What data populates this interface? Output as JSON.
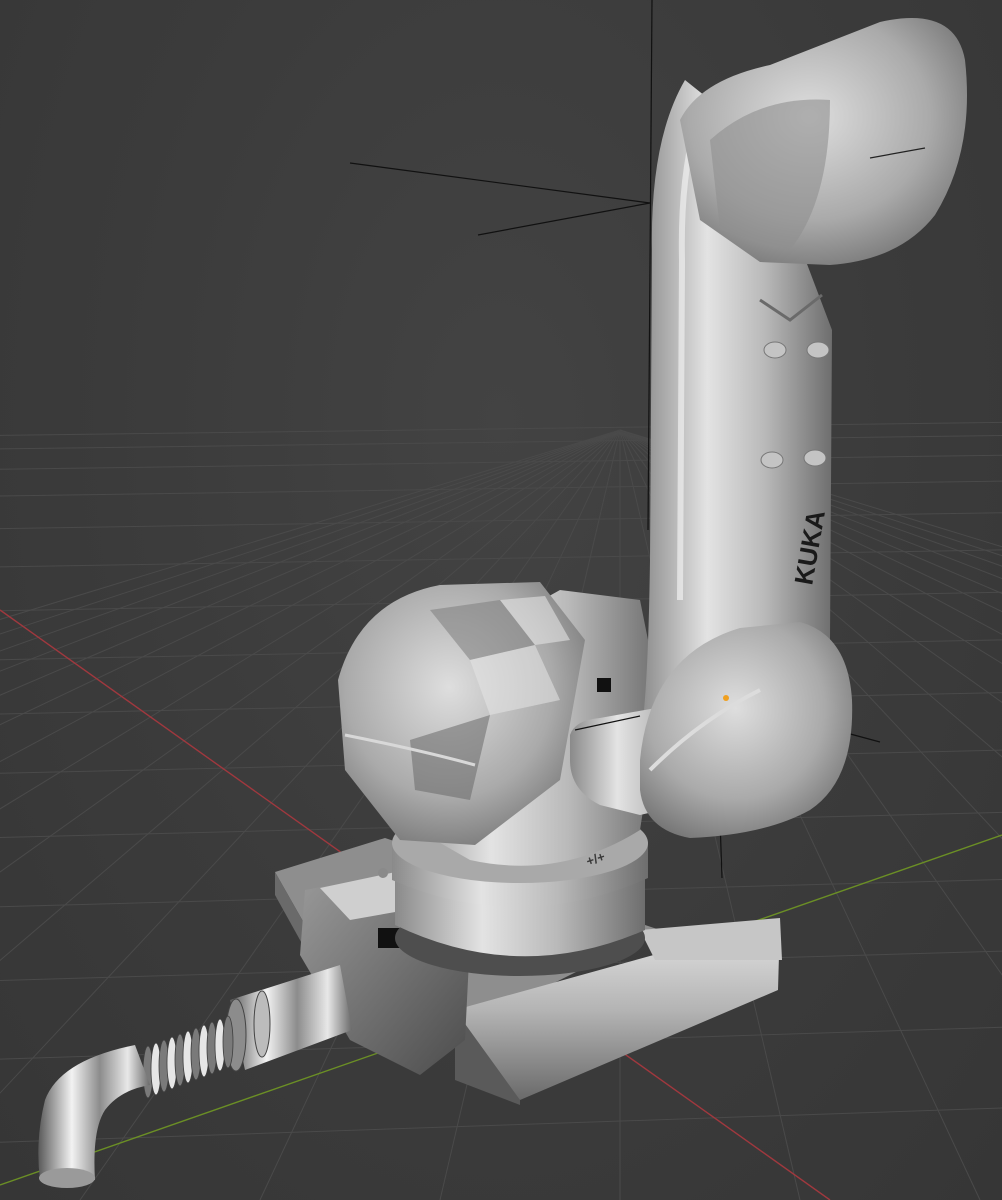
{
  "viewport": {
    "background_color": "#3d3d3d",
    "grid_color": "#4a4a4a",
    "x_axis_color": "#a0383e",
    "y_axis_color": "#6b8f25"
  },
  "model": {
    "brand_label": "KUKA",
    "marking_label": "+/+",
    "metal_light": "#e4e4e4",
    "metal_mid": "#a9a9a9",
    "metal_dark": "#5c5c5c",
    "chrome_color": "#cfcfcf",
    "origin_dot_color": "#f0a020"
  }
}
